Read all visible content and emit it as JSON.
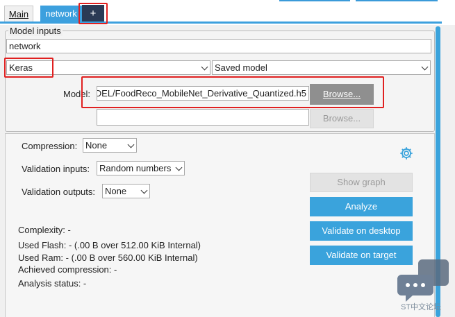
{
  "tabs": {
    "main_label": "Main",
    "network_label": "network",
    "add_label": "+"
  },
  "model_inputs": {
    "legend": "Model inputs",
    "name_value": "network",
    "framework_value": "Keras",
    "model_type_value": "Saved model",
    "model_label": "Model:",
    "model_path_value": "DEL/FoodReco_MobileNet_Derivative_Quantized.h5",
    "browse_label": "Browse...",
    "second_path_value": "",
    "browse2_label": "Browse..."
  },
  "settings": {
    "compression_label": "Compression:",
    "compression_value": "None",
    "validation_inputs_label": "Validation inputs:",
    "validation_inputs_value": "Random numbers",
    "validation_outputs_label": "Validation outputs:",
    "validation_outputs_value": "None"
  },
  "actions": {
    "show_graph_label": "Show graph",
    "analyze_label": "Analyze",
    "validate_desktop_label": "Validate on desktop",
    "validate_target_label": "Validate on target"
  },
  "analysis": {
    "complexity": "Complexity: -",
    "used_flash": "Used Flash: - (.00 B over 512.00 KiB Internal)",
    "used_ram": "Used Ram: - (.00 B over 560.00 KiB Internal)",
    "achieved_compression": "Achieved compression: -",
    "analysis_status": "Analysis status: -"
  },
  "watermark": {
    "text": "ST中文论坛"
  },
  "icons": {
    "settings": "gear-icon",
    "watermark": "chat-bubble-icon"
  },
  "colors": {
    "accent_blue": "#3aa3dc",
    "tab_dark": "#2b3a55",
    "highlight_red": "#e02020"
  }
}
